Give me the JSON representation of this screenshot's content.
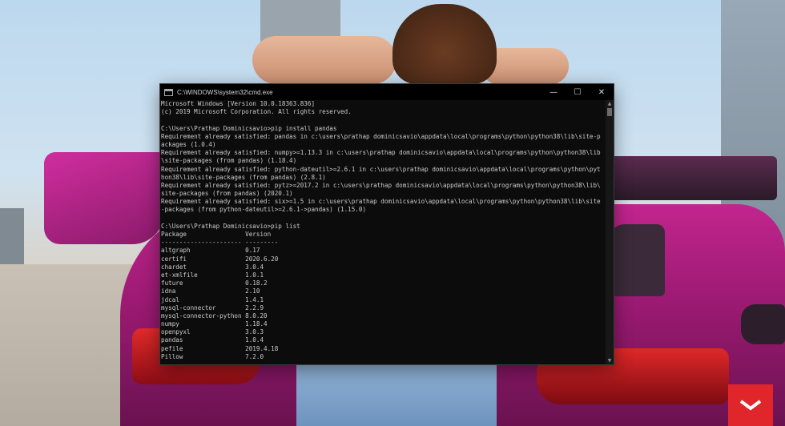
{
  "window": {
    "title": "C:\\WINDOWS\\system32\\cmd.exe",
    "controls": {
      "minimize": "—",
      "maximize": "☐",
      "close": "✕"
    },
    "icon": "console-icon"
  },
  "console": {
    "lines": [
      "Microsoft Windows [Version 10.0.18363.836]",
      "(c) 2019 Microsoft Corporation. All rights reserved.",
      "",
      "C:\\Users\\Prathap Dominicsavio>pip install pandas",
      "Requirement already satisfied: pandas in c:\\users\\prathap dominicsavio\\appdata\\local\\programs\\python\\python38\\lib\\site-p",
      "ackages (1.0.4)",
      "Requirement already satisfied: numpy>=1.13.3 in c:\\users\\prathap dominicsavio\\appdata\\local\\programs\\python\\python38\\lib",
      "\\site-packages (from pandas) (1.18.4)",
      "Requirement already satisfied: python-dateutil>=2.6.1 in c:\\users\\prathap dominicsavio\\appdata\\local\\programs\\python\\pyt",
      "hon38\\lib\\site-packages (from pandas) (2.8.1)",
      "Requirement already satisfied: pytz>=2017.2 in c:\\users\\prathap dominicsavio\\appdata\\local\\programs\\python\\python38\\lib\\",
      "site-packages (from pandas) (2020.1)",
      "Requirement already satisfied: six>=1.5 in c:\\users\\prathap dominicsavio\\appdata\\local\\programs\\python\\python38\\lib\\site",
      "-packages (from python-dateutil>=2.6.1->pandas) (1.15.0)",
      "",
      "C:\\Users\\Prathap Dominicsavio>pip list",
      "Package                Version",
      "---------------------- ---------",
      "altgraph               0.17",
      "certifi                2020.6.20",
      "chardet                3.0.4",
      "et-xmlfile             1.0.1",
      "future                 0.18.2",
      "idna                   2.10",
      "jdcal                  1.4.1",
      "mysql-connector        2.2.9",
      "mysql-connector-python 8.0.20",
      "numpy                  1.18.4",
      "openpyxl               3.0.3",
      "pandas                 1.0.4",
      "pefile                 2019.4.18",
      "Pillow                 7.2.0"
    ]
  },
  "colors": {
    "console_bg": "#0c0c0c",
    "console_fg": "#cccccc",
    "badge": "#e0262b"
  },
  "badge": {
    "icon": "chevron-down-icon"
  }
}
